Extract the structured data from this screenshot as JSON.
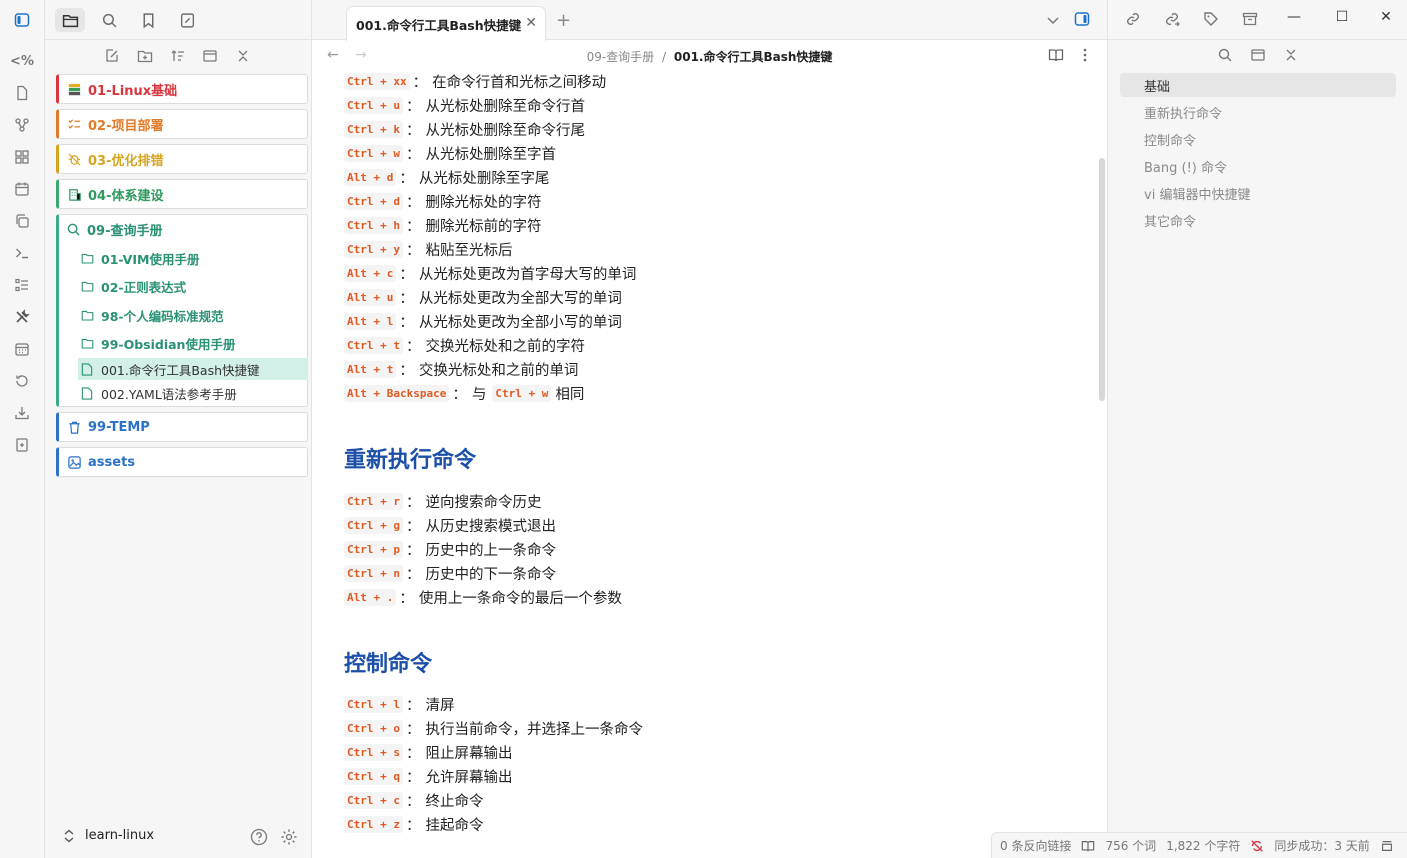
{
  "ribbon": {
    "items": [
      "code-icon",
      "file-icon",
      "graph-icon",
      "layout-icon",
      "calendar-icon",
      "copy-icon",
      "terminal-icon",
      "list-icon",
      "tools-icon",
      "calendar-grid-icon",
      "history-icon",
      "download-icon",
      "export-icon"
    ]
  },
  "code_glyph": "<%",
  "sidebar": {
    "folders": [
      {
        "label": "01-Linux基础",
        "color": "#d8353c"
      },
      {
        "label": "02-项目部署",
        "color": "#e07b29"
      },
      {
        "label": "03-优化排错",
        "color": "#d6a51f"
      },
      {
        "label": "04-体系建设",
        "color": "#3aaa6f"
      }
    ],
    "group": {
      "label": "09-查询手册",
      "subfolders": [
        "01-VIM使用手册",
        "02-正则表达式",
        "98-个人编码标准规范",
        "99-Obsidian使用手册"
      ],
      "files": [
        "001.命令行工具Bash快捷键",
        "002.YAML语法参考手册"
      ]
    },
    "temp_label": "99-TEMP",
    "assets_label": "assets",
    "vault_name": "learn-linux"
  },
  "tab": {
    "title": "001.命令行工具Bash快捷键",
    "close": "✕",
    "new": "+"
  },
  "breadcrumb": {
    "parent": "09-查询手册",
    "sep": "/",
    "current": "001.命令行工具Bash快捷键"
  },
  "doc": {
    "basic": [
      {
        "key": "Ctrl + xx",
        "desc": "在命令行首和光标之间移动"
      },
      {
        "key": "Ctrl + u",
        "desc": "从光标处删除至命令行首"
      },
      {
        "key": "Ctrl + k",
        "desc": "从光标处删除至命令行尾"
      },
      {
        "key": "Ctrl + w",
        "desc": "从光标处删除至字首"
      },
      {
        "key": "Alt + d",
        "desc": "从光标处删除至字尾"
      },
      {
        "key": "Ctrl + d",
        "desc": "删除光标处的字符"
      },
      {
        "key": "Ctrl + h",
        "desc": "删除光标前的字符"
      },
      {
        "key": "Ctrl + y",
        "desc": "粘贴至光标后"
      },
      {
        "key": "Alt + c",
        "desc": "从光标处更改为首字母大写的单词"
      },
      {
        "key": "Alt + u",
        "desc": "从光标处更改为全部大写的单词"
      },
      {
        "key": "Alt + l",
        "desc": "从光标处更改为全部小写的单词"
      },
      {
        "key": "Ctrl + t",
        "desc": "交换光标处和之前的字符"
      },
      {
        "key": "Alt + t",
        "desc": "交换光标处和之前的单词"
      }
    ],
    "backspace": {
      "key": "Alt + Backspace",
      "mid": "与",
      "key2": "Ctrl + w",
      "tail": "相同"
    },
    "h_rerun": "重新执行命令",
    "rerun": [
      {
        "key": "Ctrl + r",
        "desc": "逆向搜索命令历史"
      },
      {
        "key": "Ctrl + g",
        "desc": "从历史搜索模式退出"
      },
      {
        "key": "Ctrl + p",
        "desc": "历史中的上一条命令"
      },
      {
        "key": "Ctrl + n",
        "desc": "历史中的下一条命令"
      },
      {
        "key": "Alt + .",
        "desc": "使用上一条命令的最后一个参数"
      }
    ],
    "h_control": "控制命令",
    "control": [
      {
        "key": "Ctrl + l",
        "desc": "清屏"
      },
      {
        "key": "Ctrl + o",
        "desc": "执行当前命令，并选择上一条命令"
      },
      {
        "key": "Ctrl + s",
        "desc": "阻止屏幕输出"
      },
      {
        "key": "Ctrl + q",
        "desc": "允许屏幕输出"
      },
      {
        "key": "Ctrl + c",
        "desc": "终止命令"
      },
      {
        "key": "Ctrl + z",
        "desc": "挂起命令"
      }
    ]
  },
  "outline": [
    "基础",
    "重新执行命令",
    "控制命令",
    "Bang (!) 命令",
    "vi 编辑器中快捷键",
    "其它命令"
  ],
  "window": {
    "min": "—",
    "max": "☐",
    "close": "✕"
  },
  "status": {
    "backlinks": "0 条反向链接",
    "words": "756 个词",
    "chars": "1,822 个字符",
    "sync": "同步成功：3 天前"
  }
}
